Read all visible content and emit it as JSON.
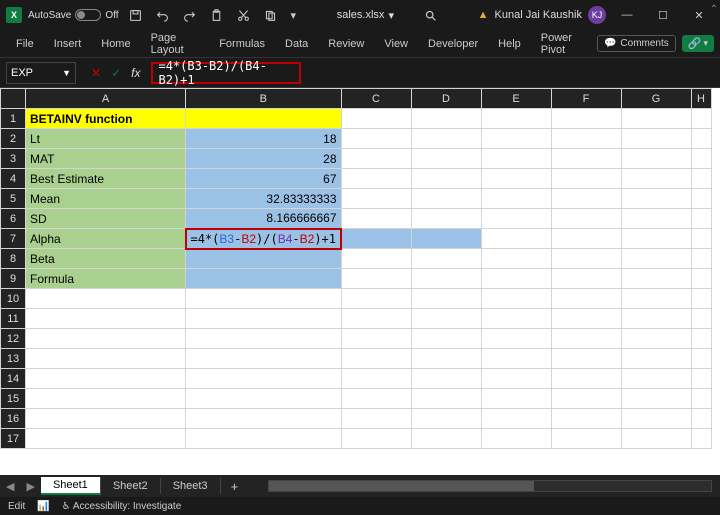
{
  "titlebar": {
    "autosave_label": "AutoSave",
    "autosave_state": "Off",
    "filename": "sales.xlsx",
    "username": "Kunal Jai Kaushik",
    "avatar_initials": "KJ"
  },
  "ribbon": {
    "tabs": [
      "File",
      "Insert",
      "Home",
      "Page Layout",
      "Formulas",
      "Data",
      "Review",
      "View",
      "Developer",
      "Help",
      "Power Pivot"
    ],
    "comments_label": "Comments"
  },
  "formula_bar": {
    "name_box": "EXP",
    "formula_text": "=4*(B3-B2)/(B4-B2)+1"
  },
  "columns": [
    "A",
    "B",
    "C",
    "D",
    "E",
    "F",
    "G",
    "H"
  ],
  "rows": [
    {
      "n": "1",
      "a": "BETAINV function",
      "b": "",
      "cls": "hdr"
    },
    {
      "n": "2",
      "a": "Lt",
      "b": "18"
    },
    {
      "n": "3",
      "a": "MAT",
      "b": "28"
    },
    {
      "n": "4",
      "a": "Best Estimate",
      "b": "67"
    },
    {
      "n": "5",
      "a": "Mean",
      "b": "32.83333333"
    },
    {
      "n": "6",
      "a": "SD",
      "b": "8.166666667"
    },
    {
      "n": "7",
      "a": "Alpha",
      "b_edit": {
        "pre": "=4*(",
        "r1": "B3",
        "m1": "-",
        "r2": "B2",
        "m2": ")/(",
        "r3": "B4",
        "m3": "-",
        "r4": "B2",
        "post": ")+1"
      }
    },
    {
      "n": "8",
      "a": "Beta",
      "b": ""
    },
    {
      "n": "9",
      "a": "Formula",
      "b": ""
    },
    {
      "n": "10"
    },
    {
      "n": "11"
    },
    {
      "n": "12"
    },
    {
      "n": "13"
    },
    {
      "n": "14"
    },
    {
      "n": "15"
    },
    {
      "n": "16"
    },
    {
      "n": "17"
    }
  ],
  "sheet_tabs": [
    "Sheet1",
    "Sheet2",
    "Sheet3"
  ],
  "active_sheet": "Sheet1",
  "status": {
    "mode": "Edit",
    "accessibility": "Accessibility: Investigate"
  }
}
